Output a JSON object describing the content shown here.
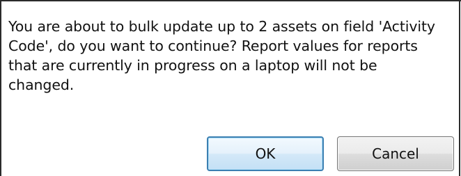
{
  "dialog": {
    "message_lines": [
      "You are about to bulk update up to 2 assets on field 'Activity",
      "Code', do you want to continue?  Report values for reports",
      "that are currently in progress on a laptop will not be",
      "changed."
    ],
    "ok_label": "OK",
    "cancel_label": "Cancel"
  }
}
